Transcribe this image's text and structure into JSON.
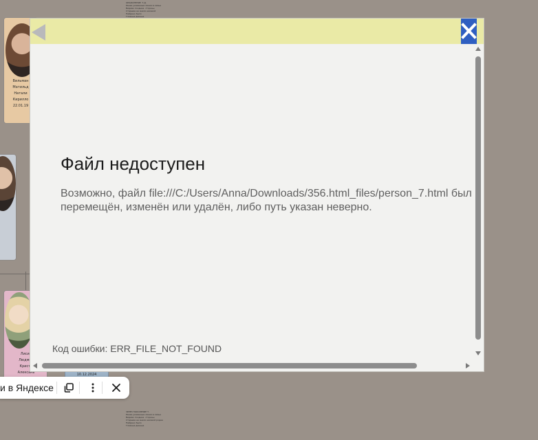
{
  "dialog": {
    "error_title": "Файл недоступен",
    "error_description": "Возможно, файл file:///C:/Users/Anna/Downloads/356.html_files/person_7.html был перемещён, изменён или удалён, либо путь указан неверно.",
    "error_code": "Код ошибки: ERR_FILE_NOT_FOUND",
    "colors": {
      "topbar": "#eaeaa6",
      "close_button": "#2f5fc1",
      "body": "#f2f2f0"
    },
    "icons": {
      "back": "back-arrow-icon",
      "close": "close-icon"
    }
  },
  "floating_toolbar": {
    "label": "и в Яндексе",
    "icons": [
      "copy-icon",
      "more-vertical-icon",
      "close-icon"
    ]
  },
  "background": {
    "color": "#9a9189",
    "card_1": {
      "lines": [
        "Вильман",
        "Матильд",
        "Натали",
        "Кирилло",
        "22.01.19"
      ]
    },
    "card_2": {
      "lines": [
        "Лисиц",
        "Людмил",
        "Кристи",
        "Алексанв"
      ]
    },
    "date_strip": "10.12.2024"
  }
}
